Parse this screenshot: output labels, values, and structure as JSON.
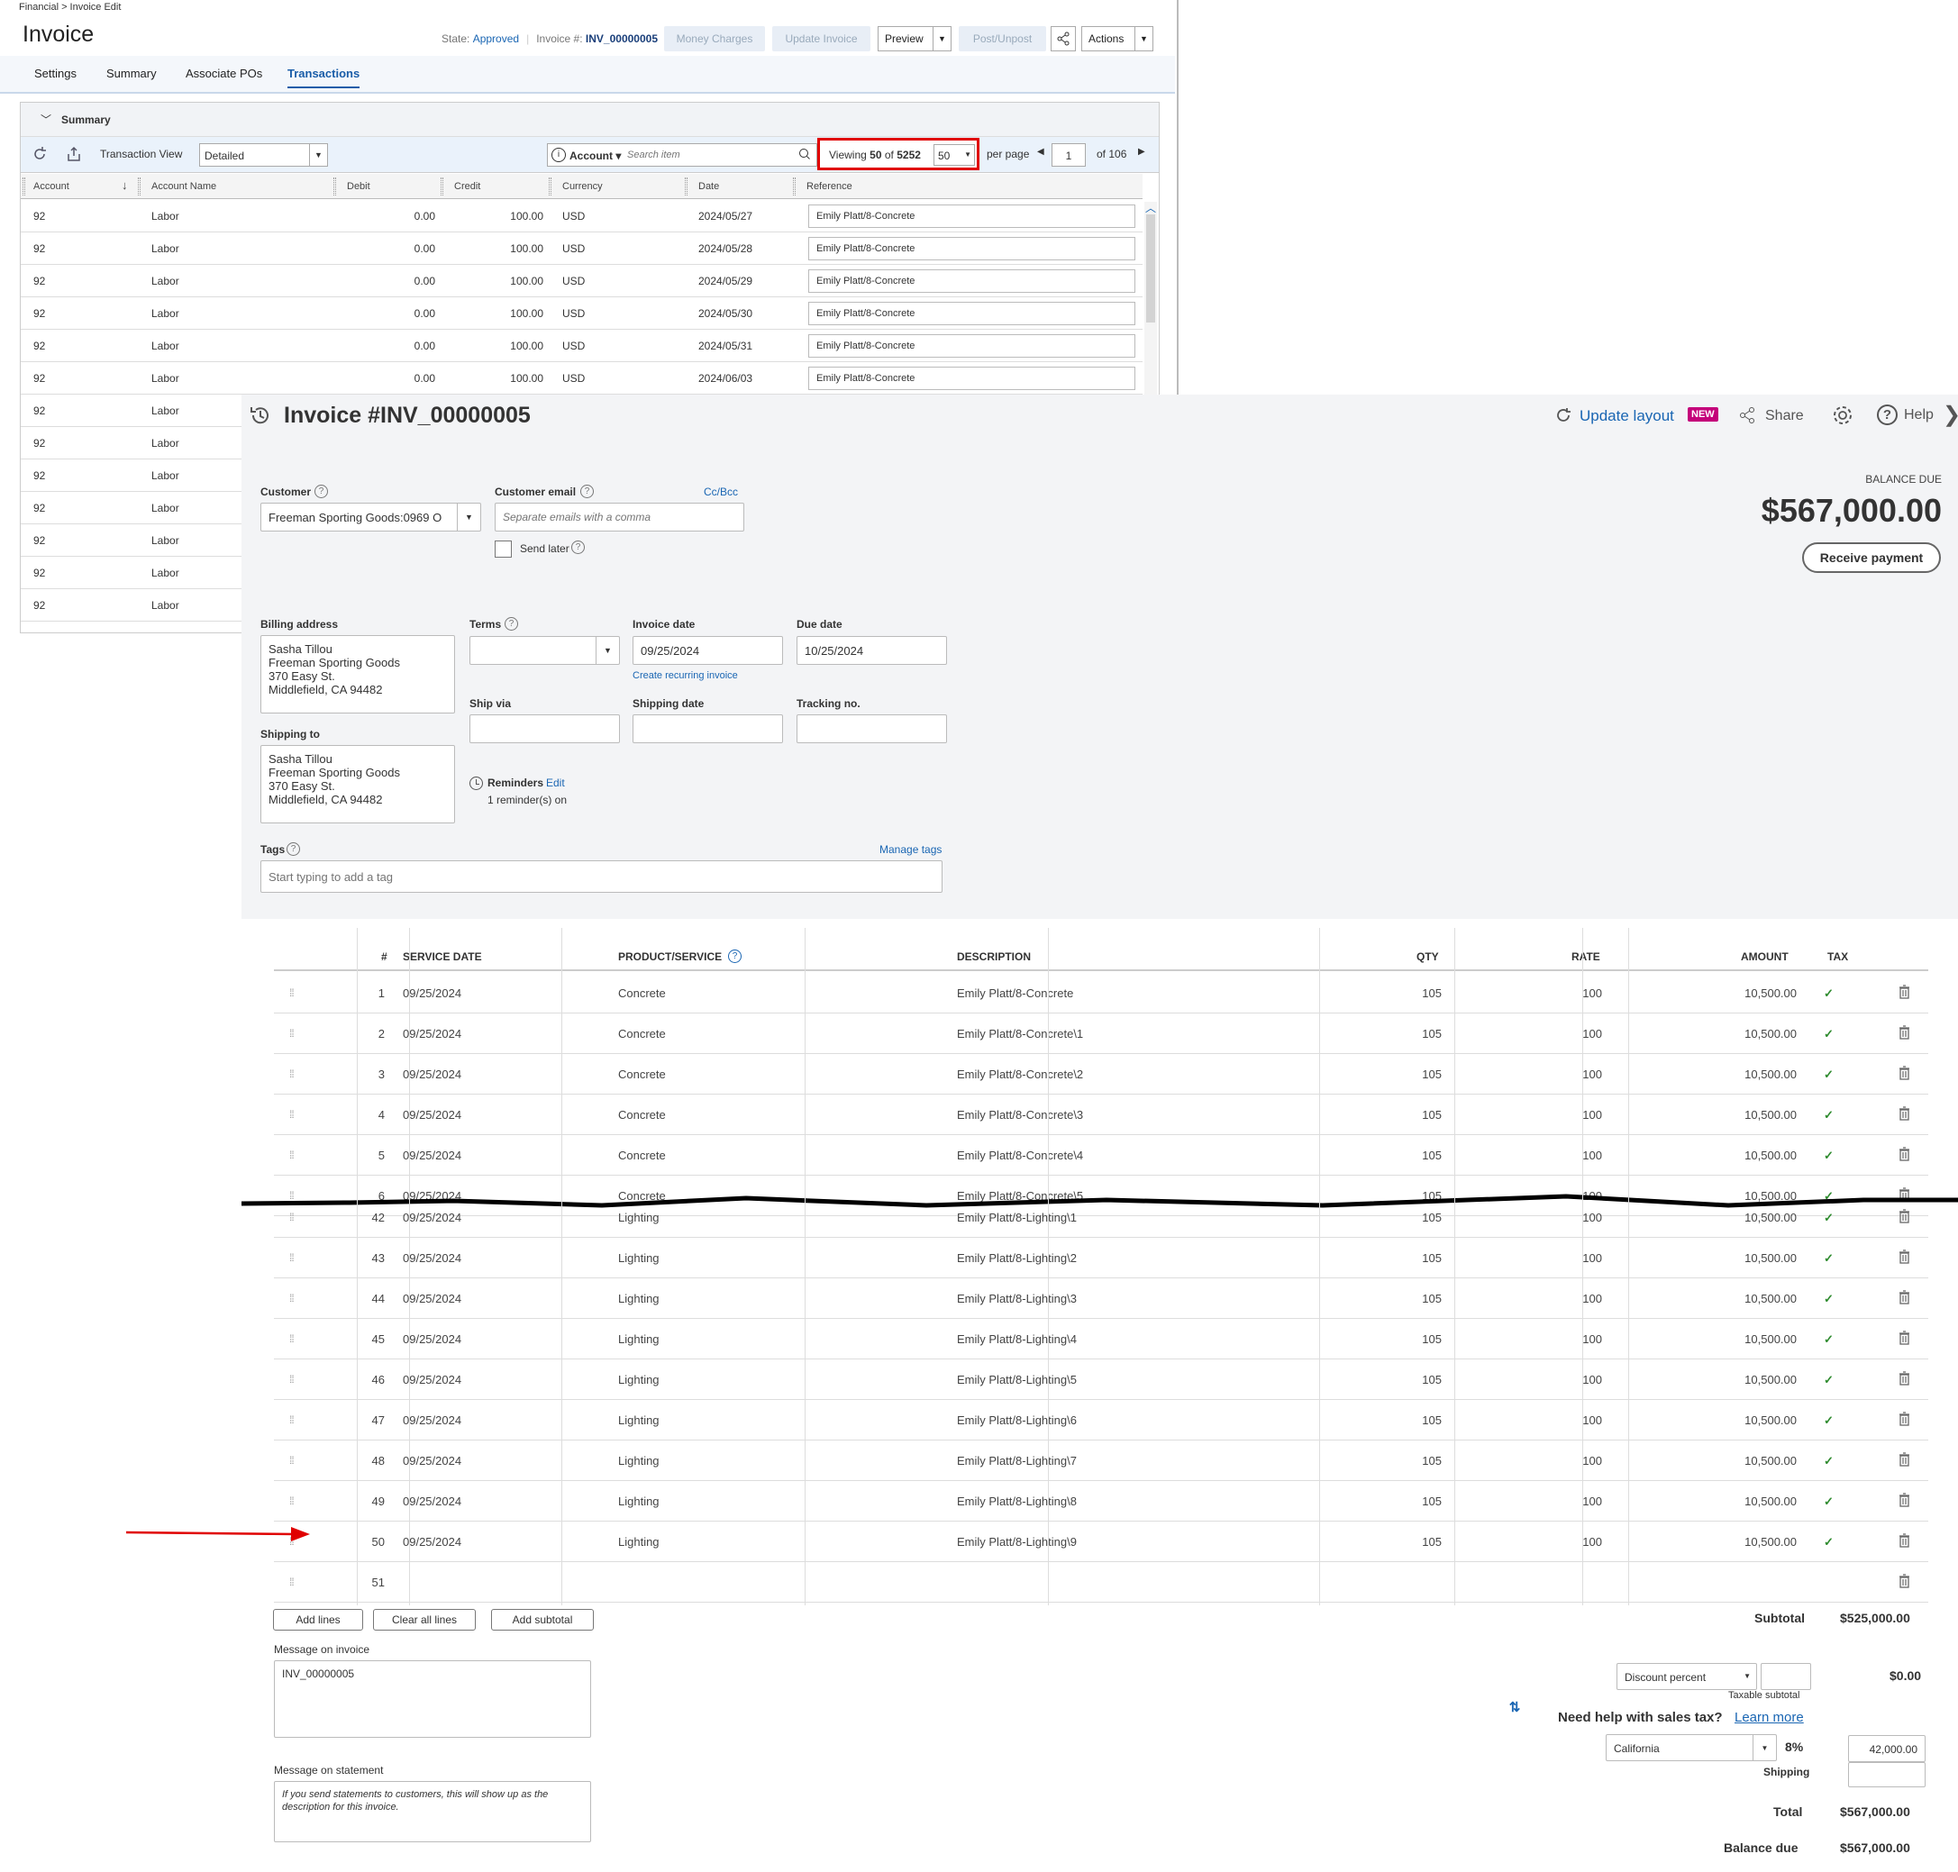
{
  "back": {
    "breadcrumb": "Financial > Invoice Edit",
    "title": "Invoice",
    "state_label": "State:",
    "state_value": "Approved",
    "invoice_label": "Invoice #:",
    "invoice_value": "INV_00000005",
    "buttons": {
      "money_charges": "Money Charges",
      "update_invoice": "Update Invoice",
      "preview": "Preview",
      "post_unpost": "Post/Unpost",
      "actions": "Actions"
    },
    "tabs": [
      "Settings",
      "Summary",
      "Associate POs",
      "Transactions"
    ],
    "active_tab": "Transactions",
    "summary_label": "Summary",
    "transaction_view_label": "Transaction View",
    "transaction_view_value": "Detailed",
    "account_filter": "Account",
    "search_placeholder": "Search item",
    "viewing_prefix": "Viewing",
    "viewing_count": "50",
    "viewing_of": "of",
    "viewing_total": "5252",
    "page_size": "50",
    "per_page": "per page",
    "page_number": "1",
    "page_of": "of 106",
    "columns": [
      "Account",
      "Account Name",
      "Debit",
      "Credit",
      "Currency",
      "Date",
      "Reference"
    ],
    "rows": [
      {
        "account": "92",
        "name": "Labor",
        "debit": "0.00",
        "credit": "100.00",
        "currency": "USD",
        "date": "2024/05/27",
        "ref": "Emily Platt/8-Concrete"
      },
      {
        "account": "92",
        "name": "Labor",
        "debit": "0.00",
        "credit": "100.00",
        "currency": "USD",
        "date": "2024/05/28",
        "ref": "Emily Platt/8-Concrete"
      },
      {
        "account": "92",
        "name": "Labor",
        "debit": "0.00",
        "credit": "100.00",
        "currency": "USD",
        "date": "2024/05/29",
        "ref": "Emily Platt/8-Concrete"
      },
      {
        "account": "92",
        "name": "Labor",
        "debit": "0.00",
        "credit": "100.00",
        "currency": "USD",
        "date": "2024/05/30",
        "ref": "Emily Platt/8-Concrete"
      },
      {
        "account": "92",
        "name": "Labor",
        "debit": "0.00",
        "credit": "100.00",
        "currency": "USD",
        "date": "2024/05/31",
        "ref": "Emily Platt/8-Concrete"
      },
      {
        "account": "92",
        "name": "Labor",
        "debit": "0.00",
        "credit": "100.00",
        "currency": "USD",
        "date": "2024/06/03",
        "ref": "Emily Platt/8-Concrete"
      },
      {
        "account": "92",
        "name": "Labor"
      },
      {
        "account": "92",
        "name": "Labor"
      },
      {
        "account": "92",
        "name": "Labor"
      },
      {
        "account": "92",
        "name": "Labor"
      },
      {
        "account": "92",
        "name": "Labor"
      },
      {
        "account": "92",
        "name": "Labor"
      },
      {
        "account": "92",
        "name": "Labor"
      }
    ]
  },
  "front": {
    "title": "Invoice #INV_00000005",
    "update_layout": "Update layout",
    "new_badge": "NEW",
    "share": "Share",
    "help": "Help",
    "customer_label": "Customer",
    "customer_value": "Freeman Sporting Goods:0969 O",
    "email_label": "Customer email",
    "cc_bcc": "Cc/Bcc",
    "email_placeholder": "Separate emails with a comma",
    "send_later": "Send later",
    "balance_due_label": "BALANCE DUE",
    "balance_due_amount": "$567,000.00",
    "receive_payment": "Receive payment",
    "billing_label": "Billing address",
    "billing_lines": [
      "Sasha Tillou",
      "Freeman Sporting Goods",
      "370 Easy St.",
      "Middlefield, CA  94482"
    ],
    "shipping_label": "Shipping to",
    "shipping_lines": [
      "Sasha Tillou",
      "Freeman Sporting Goods",
      "370 Easy St.",
      "Middlefield, CA  94482"
    ],
    "terms_label": "Terms",
    "invoice_date_label": "Invoice date",
    "invoice_date": "09/25/2024",
    "due_date_label": "Due date",
    "due_date": "10/25/2024",
    "recurring_link": "Create recurring invoice",
    "ship_via_label": "Ship via",
    "shipping_date_label": "Shipping date",
    "tracking_label": "Tracking no.",
    "reminders_label": "Reminders",
    "reminders_edit": "Edit",
    "reminders_status": "1 reminder(s) on",
    "tags_label": "Tags",
    "manage_tags": "Manage tags",
    "tags_placeholder": "Start typing to add a tag",
    "columns": [
      "#",
      "SERVICE DATE",
      "PRODUCT/SERVICE",
      "DESCRIPTION",
      "QTY",
      "RATE",
      "AMOUNT",
      "TAX"
    ],
    "lines_top": [
      {
        "n": "1",
        "date": "09/25/2024",
        "product": "Concrete",
        "desc": "Emily Platt/8-Concrete",
        "qty": "105",
        "rate": "100",
        "amount": "10,500.00"
      },
      {
        "n": "2",
        "date": "09/25/2024",
        "product": "Concrete",
        "desc": "Emily Platt/8-Concrete\\1",
        "qty": "105",
        "rate": "100",
        "amount": "10,500.00"
      },
      {
        "n": "3",
        "date": "09/25/2024",
        "product": "Concrete",
        "desc": "Emily Platt/8-Concrete\\2",
        "qty": "105",
        "rate": "100",
        "amount": "10,500.00"
      },
      {
        "n": "4",
        "date": "09/25/2024",
        "product": "Concrete",
        "desc": "Emily Platt/8-Concrete\\3",
        "qty": "105",
        "rate": "100",
        "amount": "10,500.00"
      },
      {
        "n": "5",
        "date": "09/25/2024",
        "product": "Concrete",
        "desc": "Emily Platt/8-Concrete\\4",
        "qty": "105",
        "rate": "100",
        "amount": "10,500.00"
      },
      {
        "n": "6",
        "date": "09/25/2024",
        "product": "Concrete",
        "desc": "Emily Platt/8-Concrete\\5",
        "qty": "105",
        "rate": "100",
        "amount": "10,500.00"
      }
    ],
    "lines_bottom": [
      {
        "n": "42",
        "date": "09/25/2024",
        "product": "Lighting",
        "desc": "Emily Platt/8-Lighting\\1",
        "qty": "105",
        "rate": "100",
        "amount": "10,500.00"
      },
      {
        "n": "43",
        "date": "09/25/2024",
        "product": "Lighting",
        "desc": "Emily Platt/8-Lighting\\2",
        "qty": "105",
        "rate": "100",
        "amount": "10,500.00"
      },
      {
        "n": "44",
        "date": "09/25/2024",
        "product": "Lighting",
        "desc": "Emily Platt/8-Lighting\\3",
        "qty": "105",
        "rate": "100",
        "amount": "10,500.00"
      },
      {
        "n": "45",
        "date": "09/25/2024",
        "product": "Lighting",
        "desc": "Emily Platt/8-Lighting\\4",
        "qty": "105",
        "rate": "100",
        "amount": "10,500.00"
      },
      {
        "n": "46",
        "date": "09/25/2024",
        "product": "Lighting",
        "desc": "Emily Platt/8-Lighting\\5",
        "qty": "105",
        "rate": "100",
        "amount": "10,500.00"
      },
      {
        "n": "47",
        "date": "09/25/2024",
        "product": "Lighting",
        "desc": "Emily Platt/8-Lighting\\6",
        "qty": "105",
        "rate": "100",
        "amount": "10,500.00"
      },
      {
        "n": "48",
        "date": "09/25/2024",
        "product": "Lighting",
        "desc": "Emily Platt/8-Lighting\\7",
        "qty": "105",
        "rate": "100",
        "amount": "10,500.00"
      },
      {
        "n": "49",
        "date": "09/25/2024",
        "product": "Lighting",
        "desc": "Emily Platt/8-Lighting\\8",
        "qty": "105",
        "rate": "100",
        "amount": "10,500.00"
      },
      {
        "n": "50",
        "date": "09/25/2024",
        "product": "Lighting",
        "desc": "Emily Platt/8-Lighting\\9",
        "qty": "105",
        "rate": "100",
        "amount": "10,500.00"
      },
      {
        "n": "51",
        "date": "",
        "product": "",
        "desc": "",
        "qty": "",
        "rate": "",
        "amount": ""
      }
    ],
    "add_lines": "Add lines",
    "clear_lines": "Clear all lines",
    "add_subtotal": "Add subtotal",
    "subtotal_label": "Subtotal",
    "subtotal_value": "$525,000.00",
    "message_invoice_label": "Message on invoice",
    "message_invoice_value": "INV_00000005",
    "message_statement_label": "Message on statement",
    "message_statement_placeholder": "If you send statements to customers, this will show up as the description for this invoice.",
    "discount_select": "Discount percent",
    "discount_value": "$0.00",
    "taxable_subtotal": "Taxable subtotal",
    "sales_tax_help": "Need help with sales tax?",
    "learn_more": "Learn more",
    "tax_region": "California",
    "tax_rate": "8%",
    "tax_amount": "42,000.00",
    "shipping_label2": "Shipping",
    "total_label": "Total",
    "total_value": "$567,000.00",
    "balance_label": "Balance due",
    "balance_value": "$567,000.00"
  },
  "colors": {
    "accent": "#1a66b3",
    "highlight": "#e00000",
    "check": "#2e8b2e",
    "new_badge": "#c4007a"
  }
}
